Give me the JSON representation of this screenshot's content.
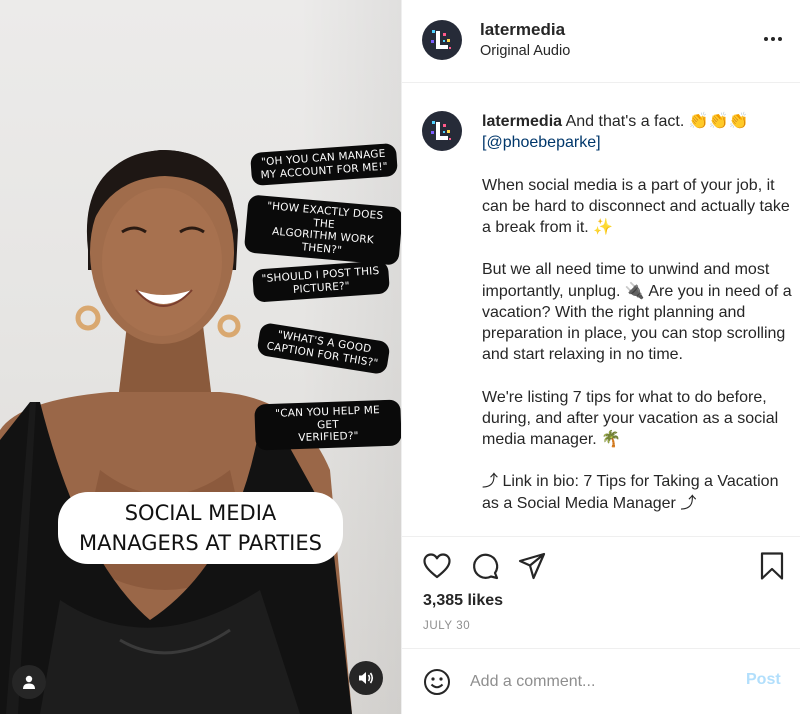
{
  "video": {
    "bubbles": [
      "\"OH YOU CAN MANAGE\nMY ACCOUNT FOR ME!\"",
      "\"HOW EXACTLY DOES THE\nALGORITHM WORK THEN?\"",
      "\"SHOULD I POST THIS\nPICTURE?\"",
      "\"WHAT'S A GOOD\nCAPTION FOR THIS?\"",
      "\"CAN YOU HELP ME GET\nVERIFIED?\""
    ],
    "caption": "SOCIAL MEDIA\nMANAGERS AT PARTIES",
    "user_icon": "person-icon",
    "sound_icon": "speaker-icon"
  },
  "header": {
    "username": "latermedia",
    "subtitle": "Original Audio",
    "more_icon": "more-dots-icon"
  },
  "caption": {
    "username": "latermedia",
    "intro": "And that's a fact. 👏👏👏",
    "mention": "[@phoebeparke]",
    "paragraphs": [
      "When social media is a part of your job, it can be hard to disconnect and actually take a break from it. ✨",
      "But we all need time to unwind and most importantly, unplug. 🔌 Are you in need of a vacation? With the right planning and preparation in place, you can stop scrolling and start relaxing in no time.",
      "We're listing 7 tips for what to do before, during, and after your vacation as a social media manager. 🌴",
      "⤴ Link in bio: 7 Tips for Taking a Vacation as a Social Media Manager ⤴"
    ]
  },
  "actions": {
    "icons": [
      "heart-icon",
      "comment-icon",
      "share-icon",
      "bookmark-icon"
    ],
    "likes": "3,385 likes",
    "date": "JULY 30"
  },
  "comment": {
    "placeholder": "Add a comment...",
    "post_label": "Post",
    "post_color": "#b2dffc"
  },
  "colors": {
    "text": "#262626",
    "muted": "#8e8e8e",
    "mention": "#00376b",
    "avatar_bg": "#262b38"
  }
}
